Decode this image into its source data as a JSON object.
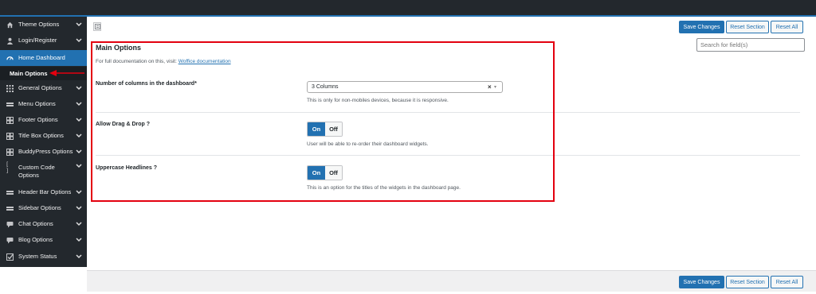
{
  "sidebar": {
    "items": [
      {
        "label": "Theme Options",
        "icon": "house-icon",
        "glyph": "⌂"
      },
      {
        "label": "Login/Register",
        "icon": "user-icon",
        "glyph": "👤"
      },
      {
        "label": "Home Dashboard",
        "icon": "dashboard-icon",
        "glyph": "◠"
      },
      {
        "label": "General Options",
        "icon": "grid-icon",
        "glyph": "⁝⁝"
      },
      {
        "label": "Menu Options",
        "icon": "menu-icon",
        "glyph": "▬"
      },
      {
        "label": "Footer Options",
        "icon": "layout-icon",
        "glyph": "⊞"
      },
      {
        "label": "Title Box Options",
        "icon": "layout-icon",
        "glyph": "⊞"
      },
      {
        "label": "BuddyPress Options",
        "icon": "layout-icon",
        "glyph": "⊞"
      },
      {
        "label": "Custom Code Options",
        "icon": "bracket-icon",
        "glyph": "[ ]"
      },
      {
        "label": "Header Bar Options",
        "icon": "menu-icon",
        "glyph": "▬"
      },
      {
        "label": "Sidebar Options",
        "icon": "menu-icon",
        "glyph": "▬"
      },
      {
        "label": "Chat Options",
        "icon": "chat-icon",
        "glyph": "▪"
      },
      {
        "label": "Blog Options",
        "icon": "chat-icon",
        "glyph": "▪"
      },
      {
        "label": "System Status",
        "icon": "checkbox-icon",
        "glyph": "☑"
      }
    ],
    "active_sub": "Main Options"
  },
  "toolbar": {
    "save_label": "Save Changes",
    "reset_section_label": "Reset Section",
    "reset_all_label": "Reset All",
    "search_placeholder": "Search for field(s)"
  },
  "section": {
    "title": "Main Options",
    "doc_prefix": "For full documentation on this, visit: ",
    "doc_link": "Woffice documentation"
  },
  "fields": {
    "columns": {
      "label": "Number of columns in the dashboard*",
      "value": "3 Columns",
      "desc": "This is only for non-mobiles devices, because it is responsive."
    },
    "drag_drop": {
      "label": "Allow Drag & Drop ?",
      "on": "On",
      "off": "Off",
      "desc": "User will be able to re-order their dashboard widgets."
    },
    "uppercase": {
      "label": "Uppercase Headlines ?",
      "on": "On",
      "off": "Off",
      "desc": "This is an option for the titles of the widgets in the dashboard page."
    }
  },
  "colors": {
    "accent": "#2271b1",
    "highlight_border": "#e3000f",
    "admin_bar": "#23282d"
  }
}
